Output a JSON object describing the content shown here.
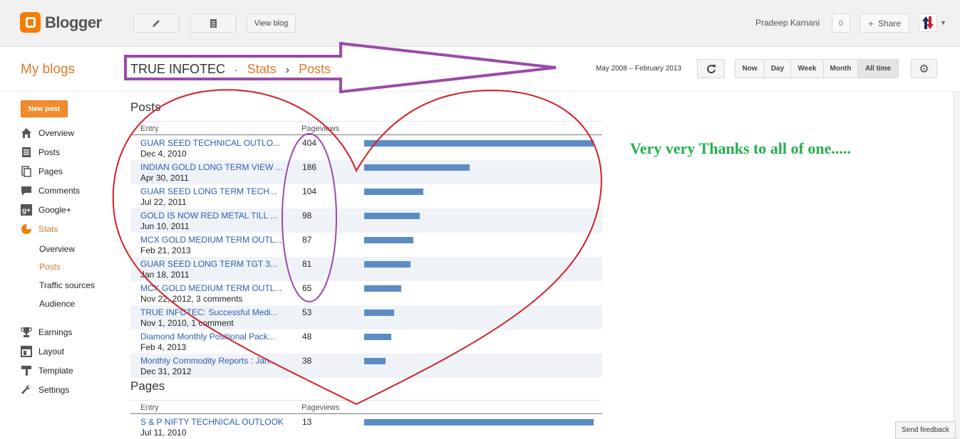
{
  "topbar": {
    "brand": "Blogger",
    "view_blog": "View blog",
    "user_name": "Pradeep Karnani",
    "notif_count": "0",
    "share_label": "Share",
    "pencil_icon": "pencil-icon",
    "pages_icon": "pages-icon"
  },
  "subheader": {
    "my_blogs": "My blogs",
    "blog_name": "TRUE INFOTEC",
    "sep1": "·",
    "crumb1": "Stats",
    "sep2": "›",
    "crumb2": "Posts",
    "range": "May 2008 – February 2013",
    "periods": [
      "Now",
      "Day",
      "Week",
      "Month",
      "All time"
    ],
    "selected_period": "All time"
  },
  "sidebar": {
    "new_post": "New post",
    "items": [
      {
        "label": "Overview",
        "icon": "home-icon"
      },
      {
        "label": "Posts",
        "icon": "posts-icon"
      },
      {
        "label": "Pages",
        "icon": "pages-icon"
      },
      {
        "label": "Comments",
        "icon": "comment-icon"
      },
      {
        "label": "Google+",
        "icon": "gplus-icon"
      },
      {
        "label": "Stats",
        "icon": "pie-icon"
      },
      {
        "label": "Earnings",
        "icon": "trophy-icon"
      },
      {
        "label": "Layout",
        "icon": "layout-icon"
      },
      {
        "label": "Template",
        "icon": "brush-icon"
      },
      {
        "label": "Settings",
        "icon": "wrench-icon"
      }
    ],
    "stats_sub": [
      "Overview",
      "Posts",
      "Traffic sources",
      "Audience"
    ],
    "active_sub": "Posts"
  },
  "posts": {
    "title": "Posts",
    "col_entry": "Entry",
    "col_pageviews": "Pageviews",
    "rows": [
      {
        "title": "GUAR SEED TECHNICAL OUTLO...",
        "sub": "Dec 4, 2010",
        "pageviews": "404",
        "value": 404
      },
      {
        "title": "INDIAN GOLD LONG TERM VIEW ...",
        "sub": "Apr 30, 2011",
        "pageviews": "186",
        "value": 186
      },
      {
        "title": "GUAR SEED LONG TERM TECH...",
        "sub": "Jul 22, 2011",
        "pageviews": "104",
        "value": 104
      },
      {
        "title": "GOLD IS NOW RED METAL TILL ...",
        "sub": "Jun 10, 2011",
        "pageviews": "98",
        "value": 98
      },
      {
        "title": "MCX GOLD MEDIUM TERM OUTL...",
        "sub": "Feb 21, 2013",
        "pageviews": "87",
        "value": 87
      },
      {
        "title": "GUAR SEED LONG TERM TGT 3...",
        "sub": "Jan 18, 2011",
        "pageviews": "81",
        "value": 81
      },
      {
        "title": "MCX GOLD MEDIUM TERM OUTL...",
        "sub": "Nov 22, 2012, 3 comments",
        "pageviews": "65",
        "value": 65
      },
      {
        "title": "TRUE INFOTEC: Successful Medi...",
        "sub": "Nov 1, 2010, 1 comment",
        "pageviews": "53",
        "value": 53
      },
      {
        "title": "Diamond Monthly Positional Pack...",
        "sub": "Feb 4, 2013",
        "pageviews": "48",
        "value": 48
      },
      {
        "title": "Monthly Commodity Reports : Jan...",
        "sub": "Dec 31, 2012",
        "pageviews": "38",
        "value": 38
      }
    ]
  },
  "pages": {
    "title": "Pages",
    "col_entry": "Entry",
    "col_pageviews": "Pageviews",
    "rows": [
      {
        "title": "S & P NIFTY TECHNICAL OUTLOOK",
        "sub": "Jul 11, 2010",
        "pageviews": "13",
        "value": 13
      }
    ]
  },
  "annotation": {
    "thanks": "Very very Thanks to all of one.....",
    "arrow_color": "#9b4aa8",
    "heart_color": "#d22027"
  },
  "feedback": "Send feedback",
  "colors": {
    "accent": "#dd7a28",
    "bar": "#5b8cc6",
    "link": "#2a5db0"
  }
}
